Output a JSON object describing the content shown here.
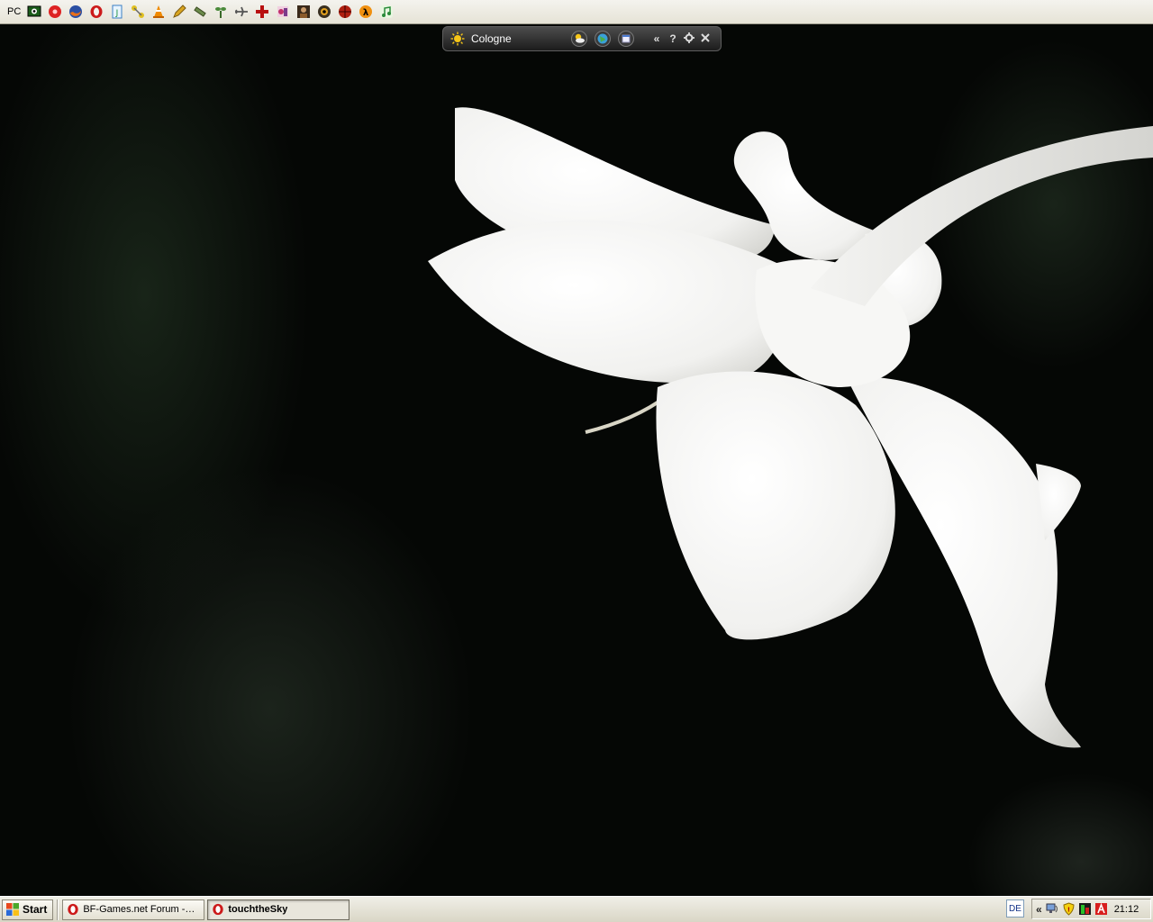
{
  "top_toolbar": {
    "label": "PC",
    "icons": [
      "monitor-eye-icon",
      "red-disc-icon",
      "firefox-icon",
      "opera-icon",
      "document-j-icon",
      "network-icon",
      "vlc-cone-icon",
      "pencil-icon",
      "wrench-icon",
      "plant-icon",
      "airplane-icon",
      "red-cross-icon",
      "paint-icon",
      "portrait-icon",
      "eye-disc-icon",
      "red-ball-icon",
      "half-life-icon",
      "music-note-icon"
    ]
  },
  "weather_gadget": {
    "city": "Cologne",
    "controls": {
      "collapse": "«",
      "help": "?"
    }
  },
  "taskbar": {
    "start_label": "Start",
    "tasks": [
      {
        "label": "BF-Games.net Forum -> ...",
        "icon": "opera-icon",
        "active": false
      },
      {
        "label": "touchtheSky",
        "icon": "opera-icon",
        "active": true
      }
    ],
    "language": "DE",
    "tray_chevron": "«",
    "clock": "21:12"
  },
  "colors": {
    "taskbar": "#e4e1d3",
    "gadget": "#2a2a2a",
    "desktop": "#050705"
  }
}
